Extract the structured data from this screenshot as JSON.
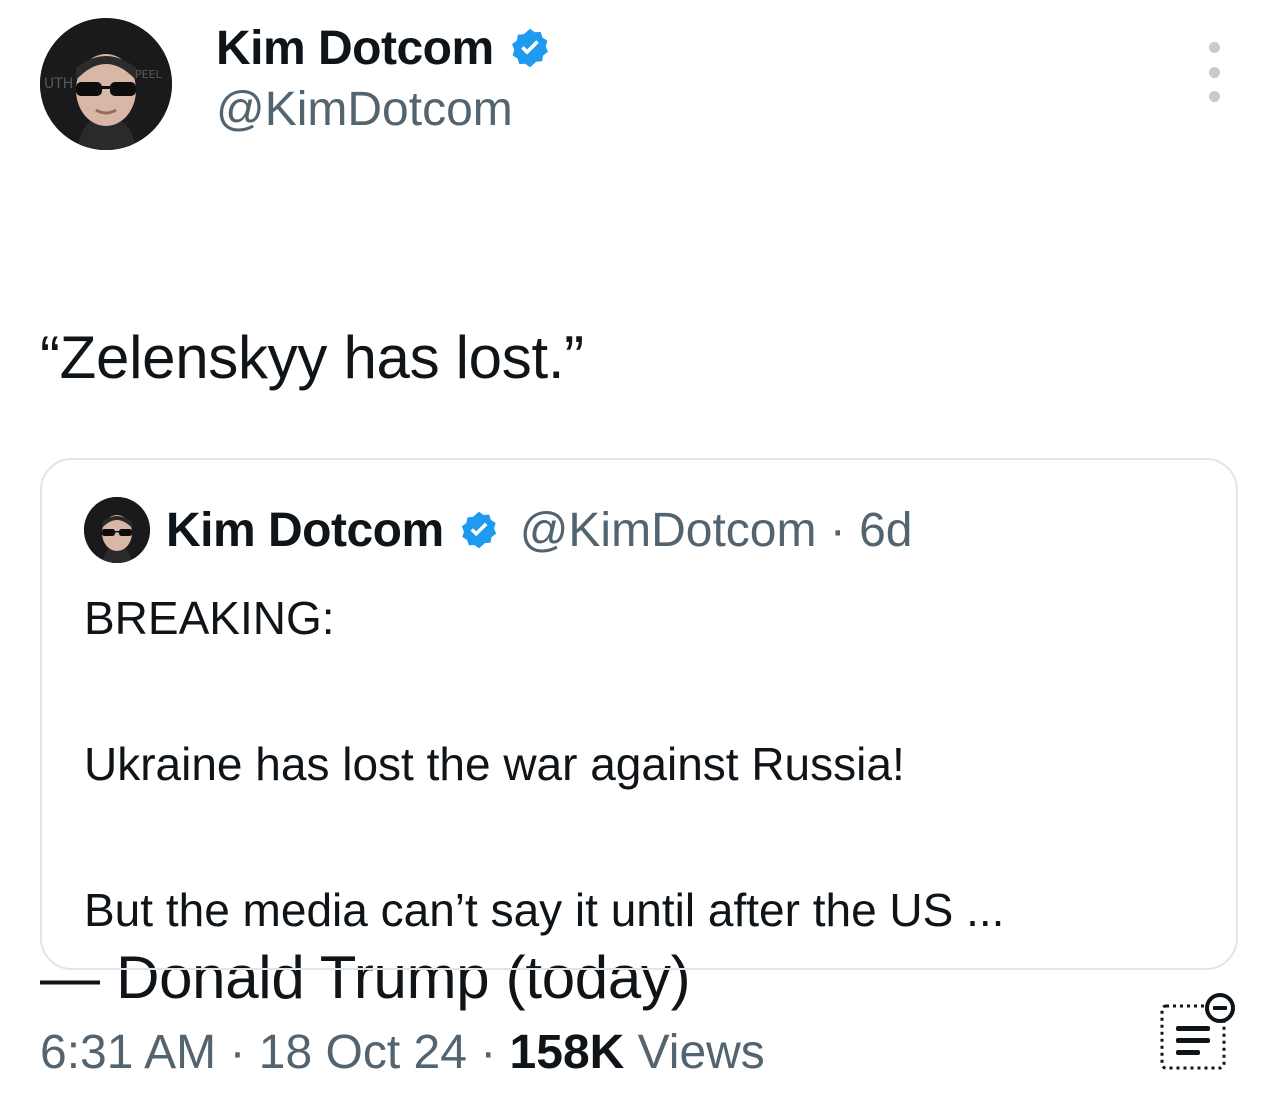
{
  "author": {
    "name": "Kim Dotcom",
    "handle": "@KimDotcom",
    "verified_icon": "verified-badge-icon",
    "verified_color": "#1d9bf0"
  },
  "tweet": {
    "line1": "“Zelenskyy has lost.”",
    "line2": "— Donald Trump (today)"
  },
  "quoted": {
    "name": "Kim Dotcom",
    "handle": "@KimDotcom",
    "separator": " · ",
    "age": "6d",
    "line1": "BREAKING:",
    "line2": "Ukraine has lost the war against Russia!",
    "line3": "But the media can’t say it until after the US ..."
  },
  "footer": {
    "time": "6:31 AM",
    "sep1": " · ",
    "date": "18 Oct 24",
    "sep2": " · ",
    "views_count": "158K",
    "views_label": " Views"
  },
  "icons": {
    "more": "more-icon",
    "analytics": "analytics-icon"
  }
}
